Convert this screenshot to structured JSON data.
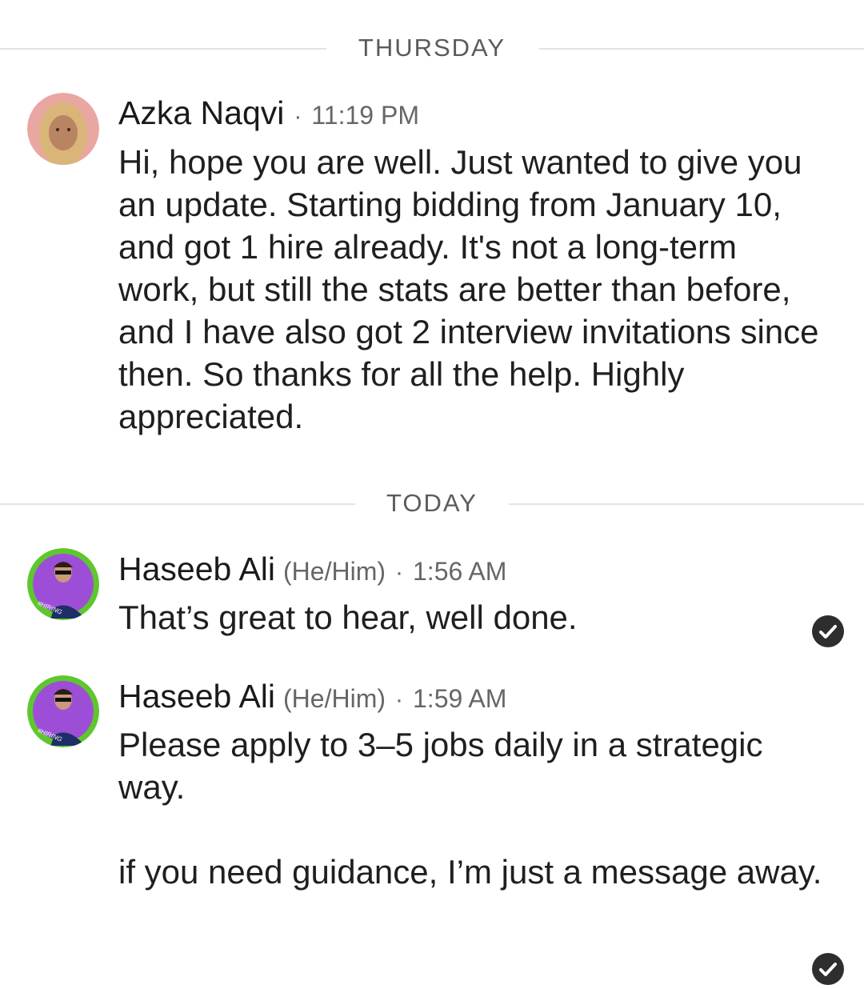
{
  "dividers": {
    "thursday": "THURSDAY",
    "today": "TODAY"
  },
  "messages": [
    {
      "sender": "Azka Naqvi",
      "pronouns": "",
      "separator": "·",
      "time": "11:19 PM",
      "text": "Hi, hope you are well. Just wanted to give you an update. Starting bidding from January 10, and got 1 hire already. It's not a long-term work, but still the stats are better than before, and I have also got 2 interview invitations since then. So thanks for all the help. Highly appreciated."
    },
    {
      "sender": "Haseeb Ali",
      "pronouns": "(He/Him)",
      "separator": "·",
      "time": "1:56 AM",
      "text": "That’s great to hear, well done.",
      "avatar_badge": "#HIRING"
    },
    {
      "sender": "Haseeb Ali",
      "pronouns": "(He/Him)",
      "separator": "·",
      "time": "1:59 AM",
      "text": "Please apply to 3–5 jobs daily in a strategic way.\n\nif you need guidance, I’m just a message away.",
      "avatar_badge": "#HIRING"
    }
  ],
  "colors": {
    "hiring_ring": "#5fc72e",
    "read_receipt": "#2e2e2e",
    "divider_line": "#e3e3e3"
  },
  "icons": {
    "read_receipt": "check-circle-icon"
  }
}
